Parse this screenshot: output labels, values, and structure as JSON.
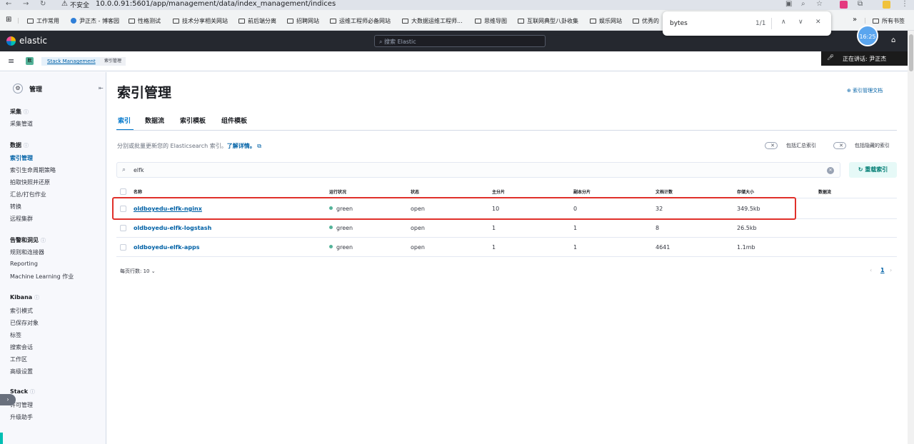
{
  "browser": {
    "security": "不安全",
    "url": "10.0.0.91:5601/app/management/data/index_management/indices",
    "bookmarks": [
      "工作常用",
      "尹正杰 - 博客园",
      "性格测试",
      "技术分享相关网站",
      "前后端分离",
      "招聘网站",
      "运维工程师必备网站",
      "大数据运维工程师...",
      "思维导图",
      "互联网典型八卦收集",
      "娱乐网站",
      "优秀的"
    ],
    "bookmarks_overflow": "»",
    "all_bookmarks": "所有书签",
    "find": {
      "query": "bytes",
      "count": "1/1"
    },
    "clock": "16:25"
  },
  "kibana": {
    "brand": "elastic",
    "search_placeholder": "搜索 Elastic",
    "space_badge": "默",
    "breadcrumbs": [
      "Stack Management",
      "索引管理"
    ],
    "voice_status": "正在讲话: 尹正杰"
  },
  "sidebar": {
    "title": "管理",
    "groups": [
      {
        "label": "采集",
        "items": [
          "采集管道"
        ]
      },
      {
        "label": "数据",
        "items": [
          "索引管理",
          "索引生命周期策略",
          "拍取快照并还原",
          "汇总/打包作业",
          "转换",
          "远程集群"
        ]
      },
      {
        "label": "告警和洞见",
        "items": [
          "规则和连接器",
          "Reporting",
          "Machine Learning 作业"
        ]
      },
      {
        "label": "Kibana",
        "items": [
          "索引模式",
          "已保存对象",
          "标签",
          "搜索会话",
          "工作区",
          "高级设置"
        ]
      },
      {
        "label": "Stack",
        "items": [
          "许可管理",
          "升级助手"
        ]
      }
    ],
    "active": "索引管理"
  },
  "main": {
    "title": "索引管理",
    "doc_link": "索引管理文档",
    "tabs": [
      "索引",
      "数据流",
      "索引模板",
      "组件模板"
    ],
    "active_tab": "索引",
    "description": "分别或批量更新您的 Elasticsearch 索引。",
    "learn_more": "了解详情。",
    "toggle_rollup": "包括汇总索引",
    "toggle_hidden": "包括隐藏的索引",
    "search_value": "elfk",
    "reload_button": "重载索引",
    "columns": [
      "名称",
      "运行状况",
      "状态",
      "主分片",
      "副本分片",
      "文档计数",
      "存储大小",
      "数据流"
    ],
    "rows": [
      {
        "name": "oldboyedu-elfk-nginx",
        "health": "green",
        "status": "open",
        "primary": "10",
        "replica": "0",
        "docs": "32",
        "size": "349.5kb",
        "stream": ""
      },
      {
        "name": "oldboyedu-elfk-logstash",
        "health": "green",
        "status": "open",
        "primary": "1",
        "replica": "1",
        "docs": "8",
        "size": "26.5kb",
        "stream": ""
      },
      {
        "name": "oldboyedu-elfk-apps",
        "health": "green",
        "status": "open",
        "primary": "1",
        "replica": "1",
        "docs": "4641",
        "size": "1.1mb",
        "stream": ""
      }
    ],
    "rows_per_page": "每页行数: 10",
    "current_page": "1"
  },
  "colors": {
    "accent": "#0077cc",
    "header": "#25282f",
    "highlight_box": "#e0302a",
    "health_green": "#54b399"
  }
}
